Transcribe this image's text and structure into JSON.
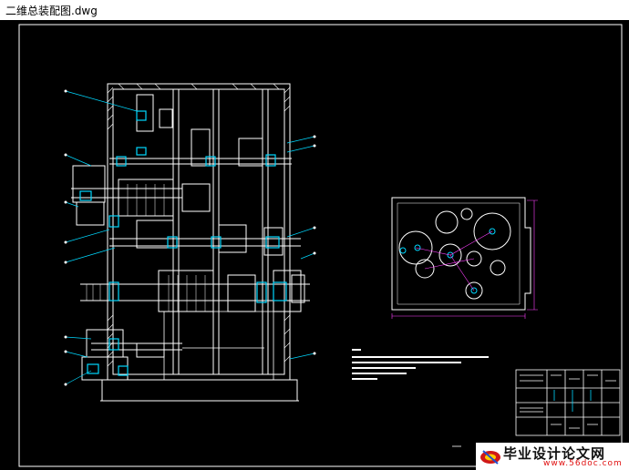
{
  "window": {
    "title": "二维总装配图.dwg"
  },
  "colors": {
    "background": "#000000",
    "linework": "#ffffff",
    "accent_cyan": "#00d8ff",
    "dim_magenta": "#ff40ff"
  },
  "watermark": {
    "brand": "毕业设计论文网",
    "url": "www.56doc.com"
  }
}
